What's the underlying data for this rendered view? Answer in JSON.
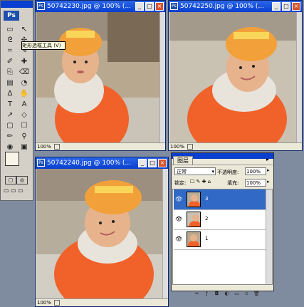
{
  "app": {
    "logo": "Ps"
  },
  "toolbox": {
    "tooltip": "矩形选框工具 (V)",
    "tools": [
      "▭",
      "↖",
      "ᘓ",
      "✣",
      "⌗",
      "✎",
      "✐",
      "✚",
      "⎘",
      "⌫",
      "▤",
      "◔",
      "∆",
      "✋",
      "T",
      "A",
      "↗",
      "◇",
      "▢",
      "☐",
      "✏",
      "⚲",
      "◉",
      "▣"
    ]
  },
  "windows": [
    {
      "title": "50742230.jpg @ 100% (...",
      "zoom": "100%"
    },
    {
      "title": "50742250.jpg @ 100% (...",
      "zoom": "100%"
    },
    {
      "title": "50742240.jpg @ 100% (...",
      "zoom": "100%"
    }
  ],
  "layers_panel": {
    "tab": "图层",
    "blend_mode": "正常",
    "opacity_label": "不透明度:",
    "opacity_value": "100%",
    "lock_label": "锁定:",
    "fill_label": "填充:",
    "fill_value": "100%",
    "layers": [
      {
        "name": "3",
        "selected": true
      },
      {
        "name": "2",
        "selected": false
      },
      {
        "name": "1",
        "selected": false
      }
    ]
  },
  "colors": {
    "titlebar": "#0a3fcf",
    "selection": "#3169c6",
    "foreground": "#f8f4e8",
    "background": "#d8df4a"
  }
}
